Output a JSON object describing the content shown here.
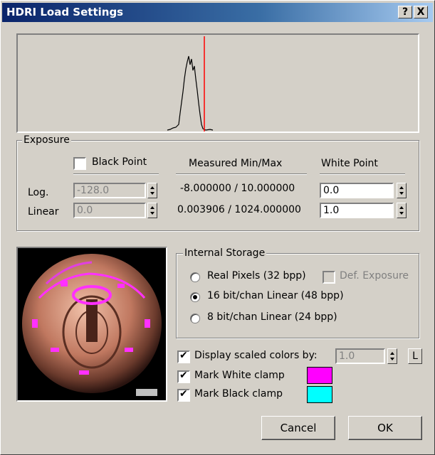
{
  "window": {
    "title": "HDRI Load Settings",
    "help_label": "?",
    "close_label": "X"
  },
  "histogram": {
    "marker_color": "#ff0000"
  },
  "exposure": {
    "legend": "Exposure",
    "black_point_label": "Black Point",
    "black_point_checked": false,
    "measured_header": "Measured Min/Max",
    "white_point_header": "White Point",
    "log_label": "Log.",
    "linear_label": "Linear",
    "black_log_value": "-128.0",
    "black_linear_value": "0.0",
    "measured_log": "-8.000000 / 10.000000",
    "measured_linear": "0.003906 / 1024.000000",
    "white_log_value": "0.0",
    "white_linear_value": "1.0"
  },
  "storage": {
    "legend": "Internal Storage",
    "options": [
      {
        "label": "Real Pixels (32 bpp)",
        "selected": false
      },
      {
        "label": "16 bit/chan Linear (48 bpp)",
        "selected": true
      },
      {
        "label": "8 bit/chan Linear (24 bpp)",
        "selected": false
      }
    ],
    "def_exposure_label": "Def. Exposure",
    "def_exposure_enabled": false
  },
  "display": {
    "scaled_colors_label": "Display scaled colors by:",
    "scaled_colors_checked": true,
    "scale_value": "1.0",
    "l_button_label": "L",
    "mark_white_label": "Mark White clamp",
    "mark_white_checked": true,
    "mark_white_color": "#ff00ff",
    "mark_black_label": "Mark Black clamp",
    "mark_black_checked": true,
    "mark_black_color": "#00ffff"
  },
  "buttons": {
    "cancel_label": "Cancel",
    "ok_label": "OK"
  }
}
